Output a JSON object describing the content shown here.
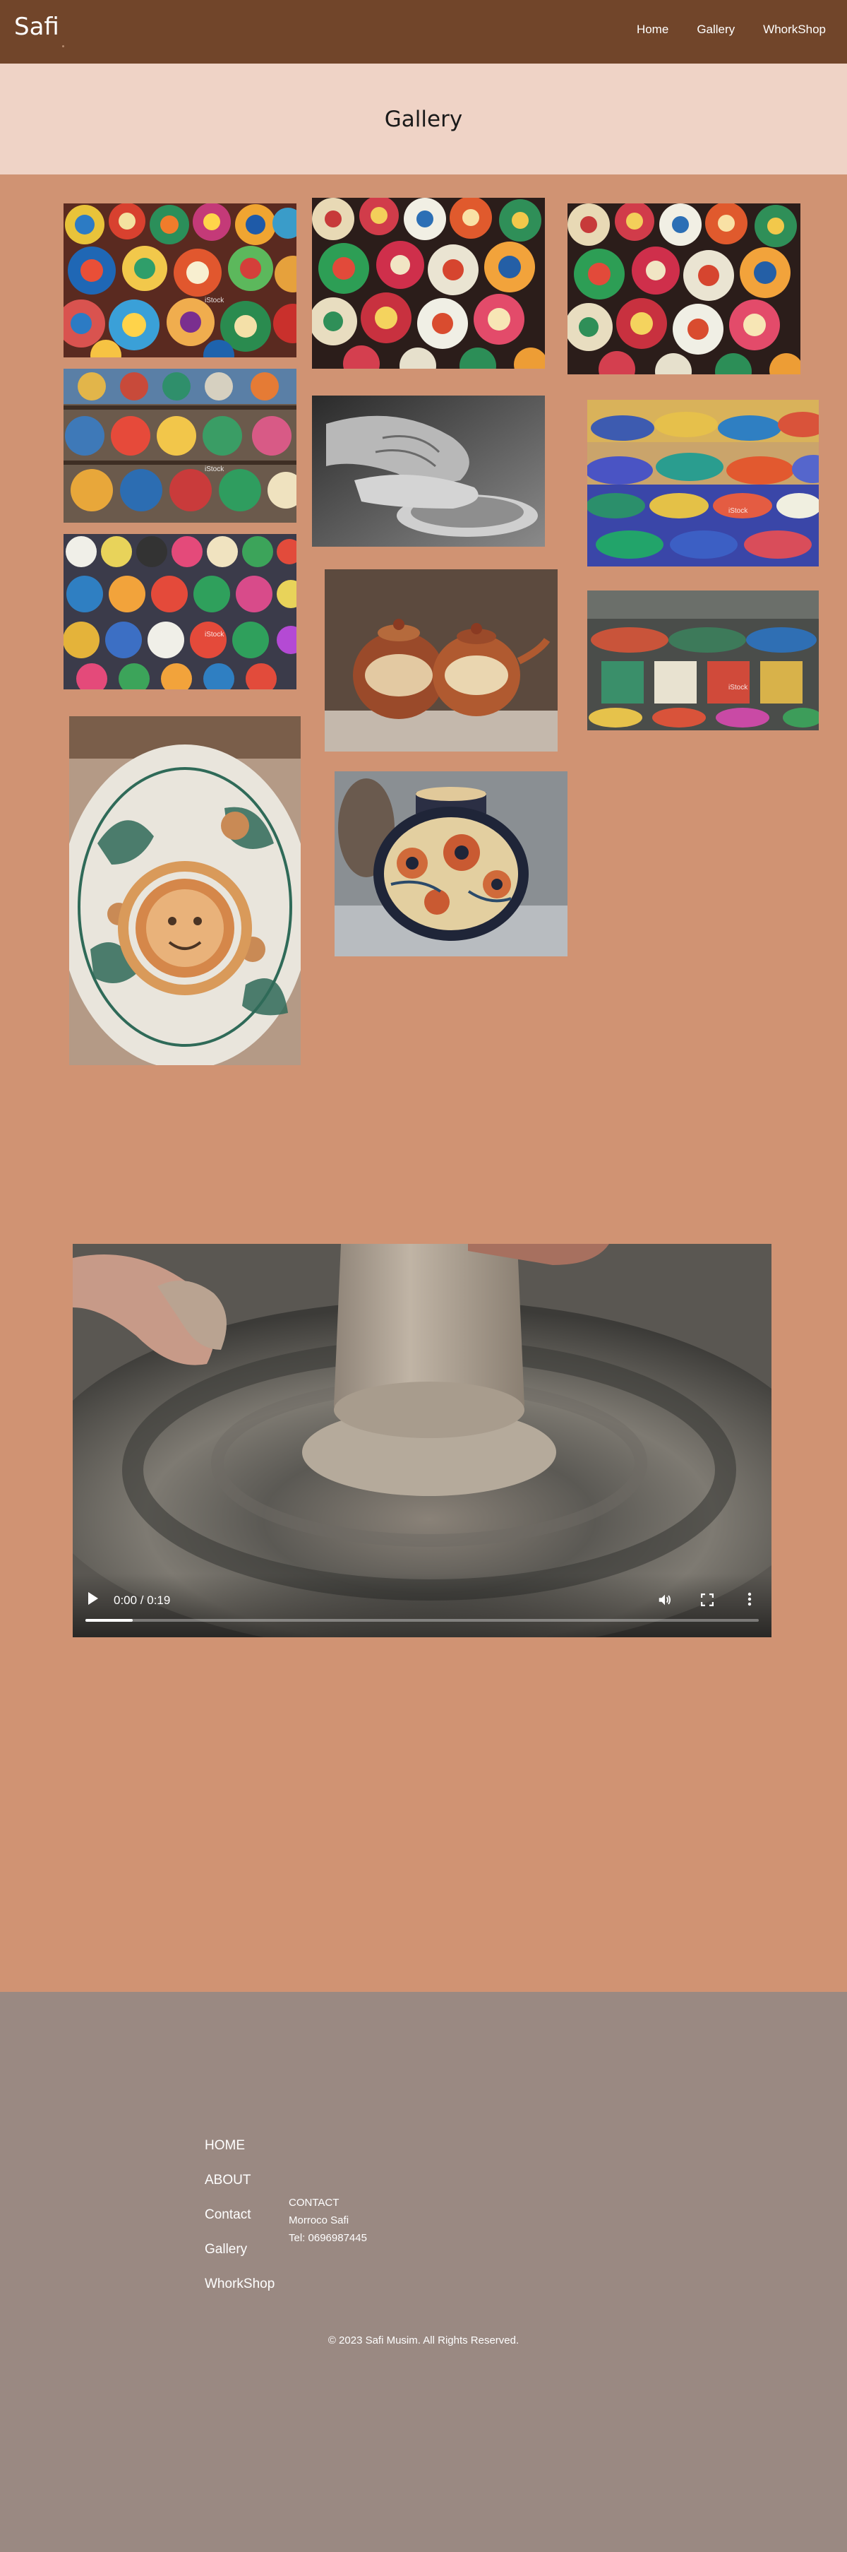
{
  "header": {
    "logo": "Safi",
    "nav": [
      "Home",
      "Gallery",
      "WhorkShop"
    ]
  },
  "banner": {
    "title": "Gallery"
  },
  "gallery": {
    "photos": [
      {
        "name": "colorful-plates-stack",
        "watermark": "iStock"
      },
      {
        "name": "painted-plates-wall",
        "watermark": ""
      },
      {
        "name": "painted-plates-wall-2",
        "watermark": ""
      },
      {
        "name": "ceramics-shelves",
        "watermark": "iStock"
      },
      {
        "name": "hands-pottery-bw",
        "watermark": ""
      },
      {
        "name": "blue-plates-stack",
        "watermark": "iStock"
      },
      {
        "name": "ceramics-market-stall",
        "watermark": "iStock"
      },
      {
        "name": "painted-teapots",
        "watermark": ""
      },
      {
        "name": "ceramics-display-table",
        "watermark": "iStock"
      },
      {
        "name": "sun-face-plate",
        "watermark": ""
      },
      {
        "name": "painted-vase",
        "watermark": ""
      }
    ]
  },
  "video": {
    "time": "0:00 / 0:19",
    "progress": 0.07
  },
  "footer": {
    "links": [
      "HOME",
      "ABOUT",
      "Contact",
      "Gallery",
      "WhorkShop"
    ],
    "contact_heading": "CONTACT",
    "contact_city": "Morroco Safi",
    "contact_phone": "Tel: 0696987445",
    "copyright": "© 2023 Safi Musim. All Rights Reserved."
  },
  "colors": {
    "header": "#71452a",
    "banner": "#efd3c6",
    "page": "#d09373",
    "footer": "#9a8982"
  }
}
